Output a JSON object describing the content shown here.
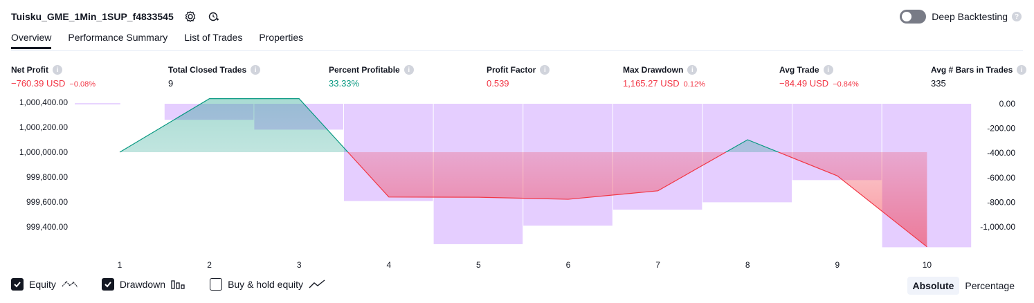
{
  "header": {
    "strategy_title": "Tuisku_GME_1Min_1SUP_f4833545",
    "deep_backtesting_label": "Deep Backtesting",
    "deep_backtesting_enabled": false
  },
  "tabs": [
    {
      "label": "Overview",
      "active": true
    },
    {
      "label": "Performance Summary",
      "active": false
    },
    {
      "label": "List of Trades",
      "active": false
    },
    {
      "label": "Properties",
      "active": false
    }
  ],
  "metrics": [
    {
      "label": "Net Profit",
      "value": "−760.39 USD",
      "sub": "−0.08%",
      "tone": "neg"
    },
    {
      "label": "Total Closed Trades",
      "value": "9",
      "sub": "",
      "tone": "neutral"
    },
    {
      "label": "Percent Profitable",
      "value": "33.33%",
      "sub": "",
      "tone": "pos"
    },
    {
      "label": "Profit Factor",
      "value": "0.539",
      "sub": "",
      "tone": "neg"
    },
    {
      "label": "Max Drawdown",
      "value": "1,165.27 USD",
      "sub": "0.12%",
      "tone": "neg"
    },
    {
      "label": "Avg Trade",
      "value": "−84.49 USD",
      "sub": "−0.84%",
      "tone": "neg"
    },
    {
      "label": "Avg # Bars in Trades",
      "value": "335",
      "sub": "",
      "tone": "neutral"
    }
  ],
  "chart_data": {
    "type": "line",
    "x": [
      1,
      2,
      3,
      4,
      5,
      6,
      7,
      8,
      9,
      10
    ],
    "x_tick_labels": [
      "1",
      "2",
      "3",
      "4",
      "5",
      "6",
      "7",
      "8",
      "9",
      "10"
    ],
    "series": [
      {
        "name": "Equity",
        "type": "line",
        "axis": "left",
        "values": [
          1000000,
          1000430,
          1000430,
          999640,
          999638,
          999622,
          999690,
          1000100,
          999810,
          999240
        ],
        "color_up": "#089981",
        "color_down": "#f23645"
      },
      {
        "name": "Drawdown",
        "type": "bar",
        "axis": "right",
        "values": [
          0,
          -130,
          -210,
          -790,
          -1140,
          -990,
          -860,
          -800,
          -620,
          -1165.27
        ],
        "color": "#e1c6ff"
      }
    ],
    "left_axis": {
      "ticks": [
        1000400,
        1000200,
        1000000,
        999800,
        999600,
        999400
      ],
      "tick_labels": [
        "1,000,400.00",
        "1,000,200.00",
        "1,000,000.00",
        "999,800.00",
        "999,600.00",
        "999,400.00"
      ]
    },
    "right_axis": {
      "ticks": [
        0,
        -200,
        -400,
        -600,
        -800,
        -1000
      ],
      "tick_labels": [
        "0.00",
        "-200.00",
        "-400.00",
        "-600.00",
        "-800.00",
        "-1,000.00"
      ]
    },
    "baseline_equity": 1000000,
    "grid": false
  },
  "legend": [
    {
      "label": "Equity",
      "checked": true,
      "icon": "equity-line-icon"
    },
    {
      "label": "Drawdown",
      "checked": true,
      "icon": "drawdown-bars-icon"
    },
    {
      "label": "Buy & hold equity",
      "checked": false,
      "icon": "buy-hold-line-icon"
    }
  ],
  "mode": {
    "absolute_label": "Absolute",
    "percentage_label": "Percentage",
    "selected": "Absolute"
  }
}
